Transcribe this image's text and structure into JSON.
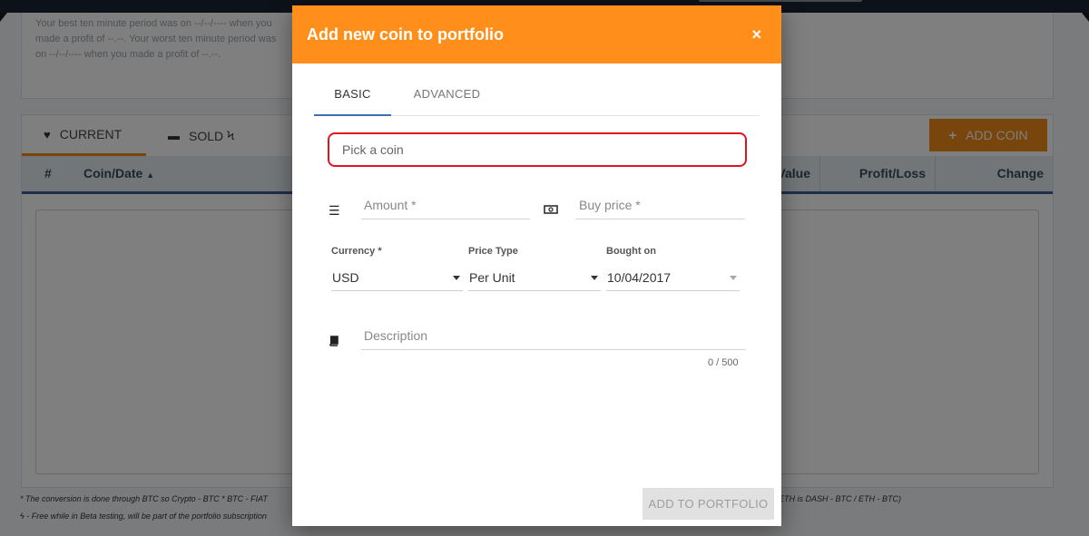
{
  "background": {
    "stats_text": "Your best ten minute period was on --/--/---- when you made a profit of --.--. Your worst ten minute period was on --/--/---- when you made a profit of --.--.",
    "tabs": [
      {
        "label": "CURRENT",
        "icon": "heartbeat-icon"
      },
      {
        "label": "SOLD",
        "icon": "minus-icon"
      }
    ],
    "add_coin_label": "ADD COIN",
    "table_headers": {
      "num": "#",
      "coin": "Coin/Date",
      "sort_indicator": "▲",
      "value": "Value",
      "profit_loss": "Profit/Loss",
      "change": "Change"
    },
    "footnote_1": "* The conversion is done through BTC so Crypto - BTC * BTC - FIAT",
    "footnote_2": "- Free while in Beta testing, will be part of the portfolio subscription",
    "footnote_right": "ETH is DASH - BTC / ETH - BTC)"
  },
  "modal": {
    "title": "Add new coin to portfolio",
    "close_glyph": "×",
    "tabs": {
      "basic": "BASIC",
      "advanced": "ADVANCED"
    },
    "coin_search": {
      "placeholder": "Pick a coin",
      "value": ""
    },
    "amount": {
      "placeholder": "Amount *",
      "value": ""
    },
    "buy_price": {
      "placeholder": "Buy price *",
      "value": ""
    },
    "currency": {
      "label": "Currency *",
      "value": "USD"
    },
    "price_type": {
      "label": "Price Type",
      "value": "Per Unit"
    },
    "bought_on": {
      "label": "Bought on",
      "value": "10/04/2017"
    },
    "description": {
      "placeholder": "Description",
      "value": "",
      "counter": "0 / 500"
    },
    "submit_label": "ADD TO PORTFOLIO"
  },
  "colors": {
    "accent_orange": "#ff8f1a",
    "tab_underline_blue": "#3b6fb3",
    "highlight_red": "#e0141e"
  }
}
